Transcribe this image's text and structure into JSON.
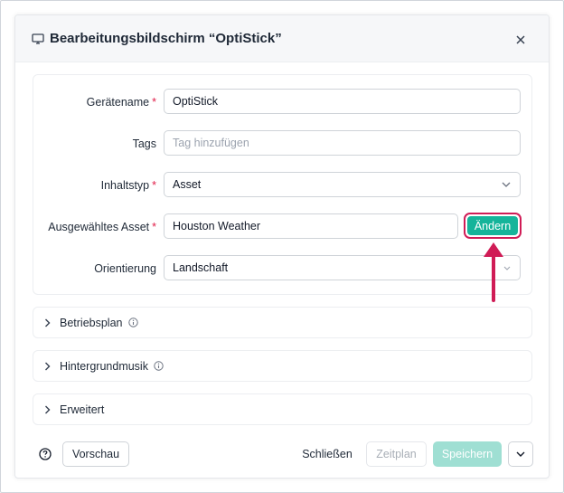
{
  "modal": {
    "title": "Bearbeitungsbildschirm “OptiStick”"
  },
  "form": {
    "device_name": {
      "label": "Gerätename",
      "required": "*",
      "value": "OptiStick"
    },
    "tags": {
      "label": "Tags",
      "placeholder": "Tag hinzufügen"
    },
    "content_type": {
      "label": "Inhaltstyp",
      "required": "*",
      "value": "Asset"
    },
    "selected_asset": {
      "label": "Ausgewähltes Asset",
      "required": "*",
      "value": "Houston Weather",
      "change_label": "Ändern"
    },
    "orientation": {
      "label": "Orientierung",
      "value": "Landschaft"
    }
  },
  "sections": [
    {
      "label": "Betriebsplan",
      "has_info": true
    },
    {
      "label": "Hintergrundmusik",
      "has_info": true
    },
    {
      "label": "Erweitert",
      "has_info": false
    }
  ],
  "footer": {
    "preview_label": "Vorschau",
    "close_label": "Schließen",
    "schedule_label": "Zeitplan",
    "save_label": "Speichern"
  },
  "colors": {
    "accent": "#15b49a",
    "accent_disabled": "#9fdfd3",
    "highlight": "#d01c56",
    "required": "#e11d48"
  },
  "icons": {
    "title": "monitor-icon",
    "close": "close-icon",
    "select": "chevron-down-icon",
    "section": "chevron-right-icon",
    "info": "info-icon",
    "help": "help-circle-icon",
    "annotation": "arrow-up-icon"
  }
}
